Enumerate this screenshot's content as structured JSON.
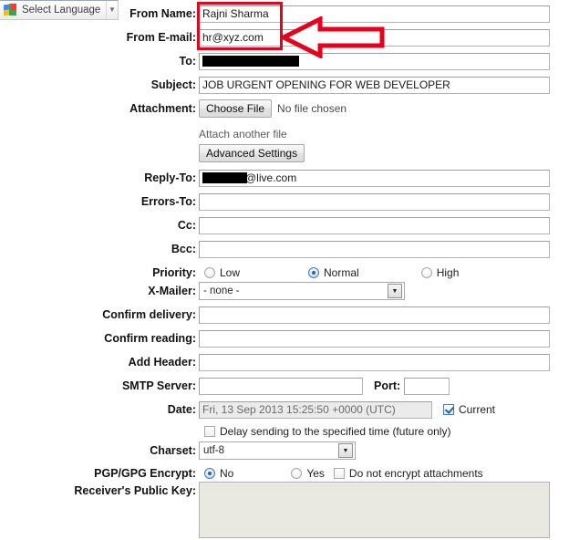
{
  "translate_widget": {
    "label": "Select Language",
    "logo_icon": "google-translate-icon",
    "dropdown_icon": "chevron-down-icon"
  },
  "annotation": {
    "highlight_color": "#e8001c",
    "arrow_icon": "left-arrow-annotation"
  },
  "form": {
    "from_name": {
      "label": "From Name:",
      "value": "Rajni Sharma"
    },
    "from_email": {
      "label": "From E-mail:",
      "value": "hr@xyz.com"
    },
    "to": {
      "label": "To:",
      "value": "",
      "redacted": true
    },
    "subject": {
      "label": "Subject:",
      "value": "JOB URGENT OPENING FOR WEB DEVELOPER"
    },
    "attachment": {
      "label": "Attachment:",
      "choose_file_button": "Choose File",
      "no_file_text": "No file chosen",
      "attach_another": "Attach another file",
      "advanced_settings_button": "Advanced Settings"
    },
    "reply_to": {
      "label": "Reply-To:",
      "value": "@live.com",
      "redacted": true
    },
    "errors_to": {
      "label": "Errors-To:",
      "value": ""
    },
    "cc": {
      "label": "Cc:",
      "value": ""
    },
    "bcc": {
      "label": "Bcc:",
      "value": ""
    },
    "priority": {
      "label": "Priority:",
      "options": [
        "Low",
        "Normal",
        "High"
      ],
      "selected": "Normal"
    },
    "x_mailer": {
      "label": "X-Mailer:",
      "value": "- none -"
    },
    "confirm_delivery": {
      "label": "Confirm delivery:",
      "value": ""
    },
    "confirm_reading": {
      "label": "Confirm reading:",
      "value": ""
    },
    "add_header": {
      "label": "Add Header:",
      "value": ""
    },
    "smtp_server": {
      "label": "SMTP Server:",
      "value": "",
      "port_label": "Port:",
      "port_value": ""
    },
    "date": {
      "label": "Date:",
      "value": "Fri, 13 Sep 2013 15:25:50 +0000 (UTC)",
      "current_label": "Current",
      "current_checked": true
    },
    "delay": {
      "label": "Delay sending to the specified time (future only)",
      "checked": false
    },
    "charset": {
      "label": "Charset:",
      "value": "utf-8"
    },
    "pgp": {
      "label": "PGP/GPG Encrypt:",
      "options": [
        "No",
        "Yes"
      ],
      "selected": "No",
      "no_encrypt_attachments_label": "Do not encrypt attachments",
      "no_encrypt_attachments_checked": false
    },
    "public_key": {
      "label": "Receiver's Public Key:",
      "value": ""
    }
  }
}
